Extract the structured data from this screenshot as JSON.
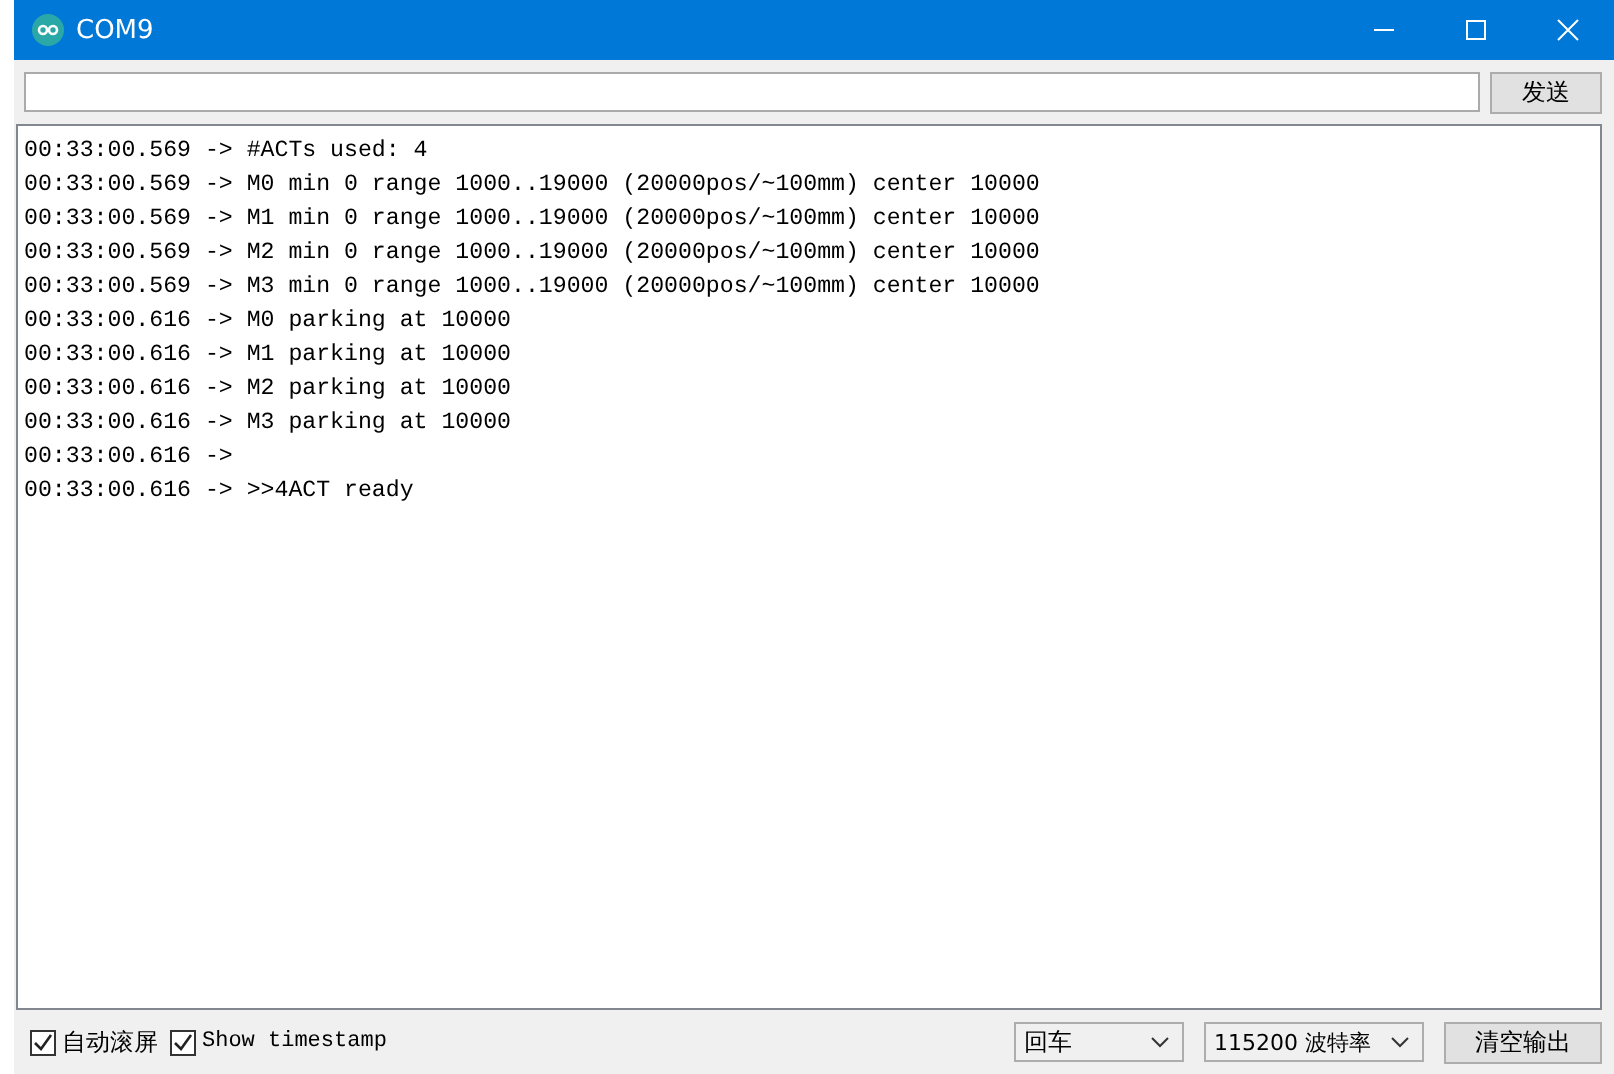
{
  "window": {
    "title": "COM9"
  },
  "send_button": "发送",
  "log_lines": [
    "00:33:00.569 -> #ACTs used: 4",
    "00:33:00.569 -> M0 min 0 range 1000..19000 (20000pos/~100mm) center 10000",
    "00:33:00.569 -> M1 min 0 range 1000..19000 (20000pos/~100mm) center 10000",
    "00:33:00.569 -> M2 min 0 range 1000..19000 (20000pos/~100mm) center 10000",
    "00:33:00.569 -> M3 min 0 range 1000..19000 (20000pos/~100mm) center 10000",
    "00:33:00.616 -> M0 parking at 10000",
    "00:33:00.616 -> M1 parking at 10000",
    "00:33:00.616 -> M2 parking at 10000",
    "00:33:00.616 -> M3 parking at 10000",
    "00:33:00.616 ->",
    "00:33:00.616 -> >>4ACT ready"
  ],
  "autoscroll": {
    "label": "自动滚屏",
    "checked": true
  },
  "show_timestamp": {
    "label": "Show timestamp",
    "checked": true
  },
  "line_ending": {
    "value": "回车"
  },
  "baud_rate": {
    "value": "115200 波特率"
  },
  "clear_button": "清空输出"
}
